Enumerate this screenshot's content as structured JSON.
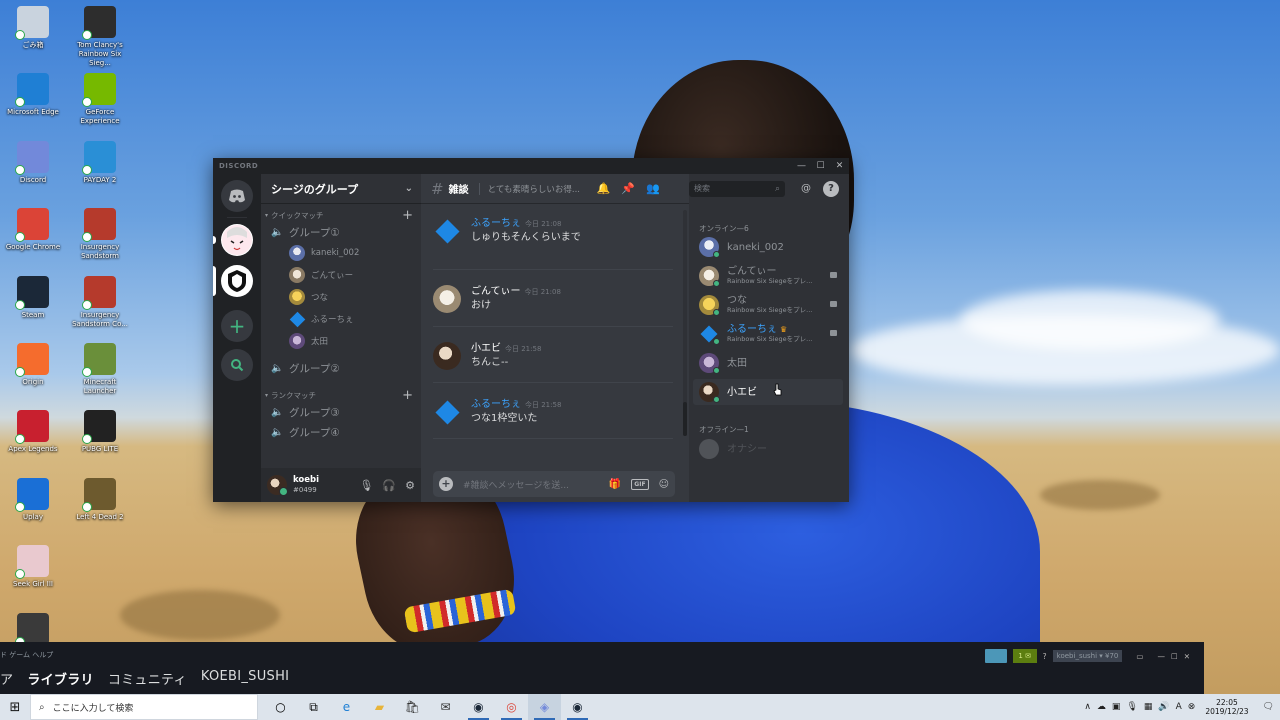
{
  "desktop": {
    "icons_left": [
      {
        "label": "ごみ箱",
        "icon": "recycle-bin-icon",
        "color": "#c9d3de"
      },
      {
        "label": "Microsoft Edge",
        "icon": "edge-icon",
        "color": "#1f7fd4"
      },
      {
        "label": "Discord",
        "icon": "discord-icon",
        "color": "#7289da"
      },
      {
        "label": "Google Chrome",
        "icon": "chrome-icon",
        "color": "#db4437"
      },
      {
        "label": "Steam",
        "icon": "steam-icon",
        "color": "#1b2838"
      },
      {
        "label": "Origin",
        "icon": "origin-icon",
        "color": "#f56c2d"
      },
      {
        "label": "Apex Legends",
        "icon": "apex-icon",
        "color": "#c8202f"
      },
      {
        "label": "Uplay",
        "icon": "uplay-icon",
        "color": "#1a6fd6"
      },
      {
        "label": "Seek Girl III",
        "icon": "seek-girl-icon",
        "color": "#e9c9cf"
      },
      {
        "label": "",
        "icon": "rainbow-six-icon",
        "color": "#3a3a3a"
      }
    ],
    "icons_right": [
      {
        "label": "Tom Clancy's Rainbow Six Sieg...",
        "icon": "rainbow-six-icon",
        "color": "#2d2d2d"
      },
      {
        "label": "GeForce Experience",
        "icon": "geforce-icon",
        "color": "#76b900"
      },
      {
        "label": "PAYDAY 2",
        "icon": "payday-icon",
        "color": "#2a8fd6"
      },
      {
        "label": "Insurgency Sandstorm",
        "icon": "insurgency-icon",
        "color": "#b53a2c"
      },
      {
        "label": "Insurgency Sandstorm Co...",
        "icon": "insurgency-icon",
        "color": "#b53a2c"
      },
      {
        "label": "Minecraft Launcher",
        "icon": "minecraft-icon",
        "color": "#6a8f3a"
      },
      {
        "label": "PUBG LITE",
        "icon": "pubg-icon",
        "color": "#222"
      },
      {
        "label": "Left 4 Dead 2",
        "icon": "l4d2-icon",
        "color": "#6d5a2e"
      }
    ]
  },
  "discord": {
    "brand": "DISCORD",
    "server_name": "シージのグループ",
    "categories": [
      {
        "name": "クイックマッチ"
      },
      {
        "name": "ランクマッチ"
      }
    ],
    "voice_channels": [
      "グループ①",
      "グループ②",
      "グループ③",
      "グループ④"
    ],
    "voice_users": [
      "kaneki_002",
      "ごんてぃー",
      "つな",
      "ふるーちぇ",
      "太田"
    ],
    "user": {
      "name": "koebi",
      "tag": "#0499"
    },
    "channel_name": "雑談",
    "channel_topic": "とても素晴らしいお得...",
    "search_placeholder": "検索",
    "composer_placeholder": "#雑談へメッセージを送...",
    "composer_gif": "GIF",
    "messages": [
      {
        "author": "ふるーちぇ",
        "time": "今日 21:08",
        "text": "しゅりもそんくらいまで",
        "author_color": "#3ca4ff"
      },
      {
        "author": "ごんてぃー",
        "time": "今日 21:08",
        "text": "おけ",
        "author_color": "#ffffff"
      },
      {
        "author": "小エビ",
        "time": "今日 21:58",
        "text": "ちんこ--",
        "author_color": "#ffffff"
      },
      {
        "author": "ふるーちぇ",
        "time": "今日 21:58",
        "text": "つな1枠空いた",
        "author_color": "#3ca4ff"
      }
    ],
    "online_header": "オンライン—6",
    "offline_header": "オフライン—1",
    "members_online": [
      {
        "name": "kaneki_002",
        "activity": "",
        "name_color": "#8e9297"
      },
      {
        "name": "ごんてぃー",
        "activity": "Rainbow Six Siegeをプレ...",
        "name_color": "#8e9297"
      },
      {
        "name": "つな",
        "activity": "Rainbow Six Siegeをプレ...",
        "name_color": "#8e9297"
      },
      {
        "name": "ふるーちぇ",
        "activity": "Rainbow Six Siegeをプレ...",
        "name_color": "#3ca4ff"
      },
      {
        "name": "太田",
        "activity": "",
        "name_color": "#8e9297"
      },
      {
        "name": "小エビ",
        "activity": "",
        "name_color": "#ffffff"
      }
    ],
    "members_offline": [
      {
        "name": "オナシー"
      }
    ]
  },
  "steam": {
    "menu": "ド  ゲーム  ヘルプ",
    "nav": [
      "ア",
      "ライブラリ",
      "コミュニティ",
      "KOEBI_SUSHI"
    ],
    "badge": "1 ✉",
    "account": "koebi_sushi ▾ ¥70"
  },
  "taskbar": {
    "search_placeholder": "ここに入力して検索",
    "time": "22:05",
    "date": "2019/12/23",
    "ime": "A"
  }
}
